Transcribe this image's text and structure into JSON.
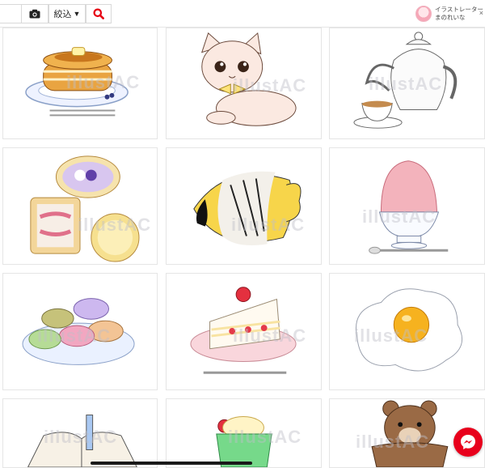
{
  "toolbar": {
    "search_value": "",
    "camera_icon": "camera-icon",
    "filter_label": "絞込",
    "filter_arrow": "▼",
    "search_icon": "search-icon",
    "accent_color": "#e60012"
  },
  "profile": {
    "role": "イラストレーター",
    "name": "まのれいな",
    "close": "×"
  },
  "watermark": "illustAC",
  "grid": {
    "items": [
      {
        "subject": "pancakes"
      },
      {
        "subject": "cat"
      },
      {
        "subject": "teapot"
      },
      {
        "subject": "cookies"
      },
      {
        "subject": "butterflyfish"
      },
      {
        "subject": "shaved-ice"
      },
      {
        "subject": "macarons"
      },
      {
        "subject": "strawberry-shortcake"
      },
      {
        "subject": "fried-egg"
      },
      {
        "subject": "notebook"
      },
      {
        "subject": "melon-soda"
      },
      {
        "subject": "bear"
      }
    ]
  },
  "floating": {
    "messenger_icon": "messenger-icon",
    "color": "#e8001c"
  }
}
